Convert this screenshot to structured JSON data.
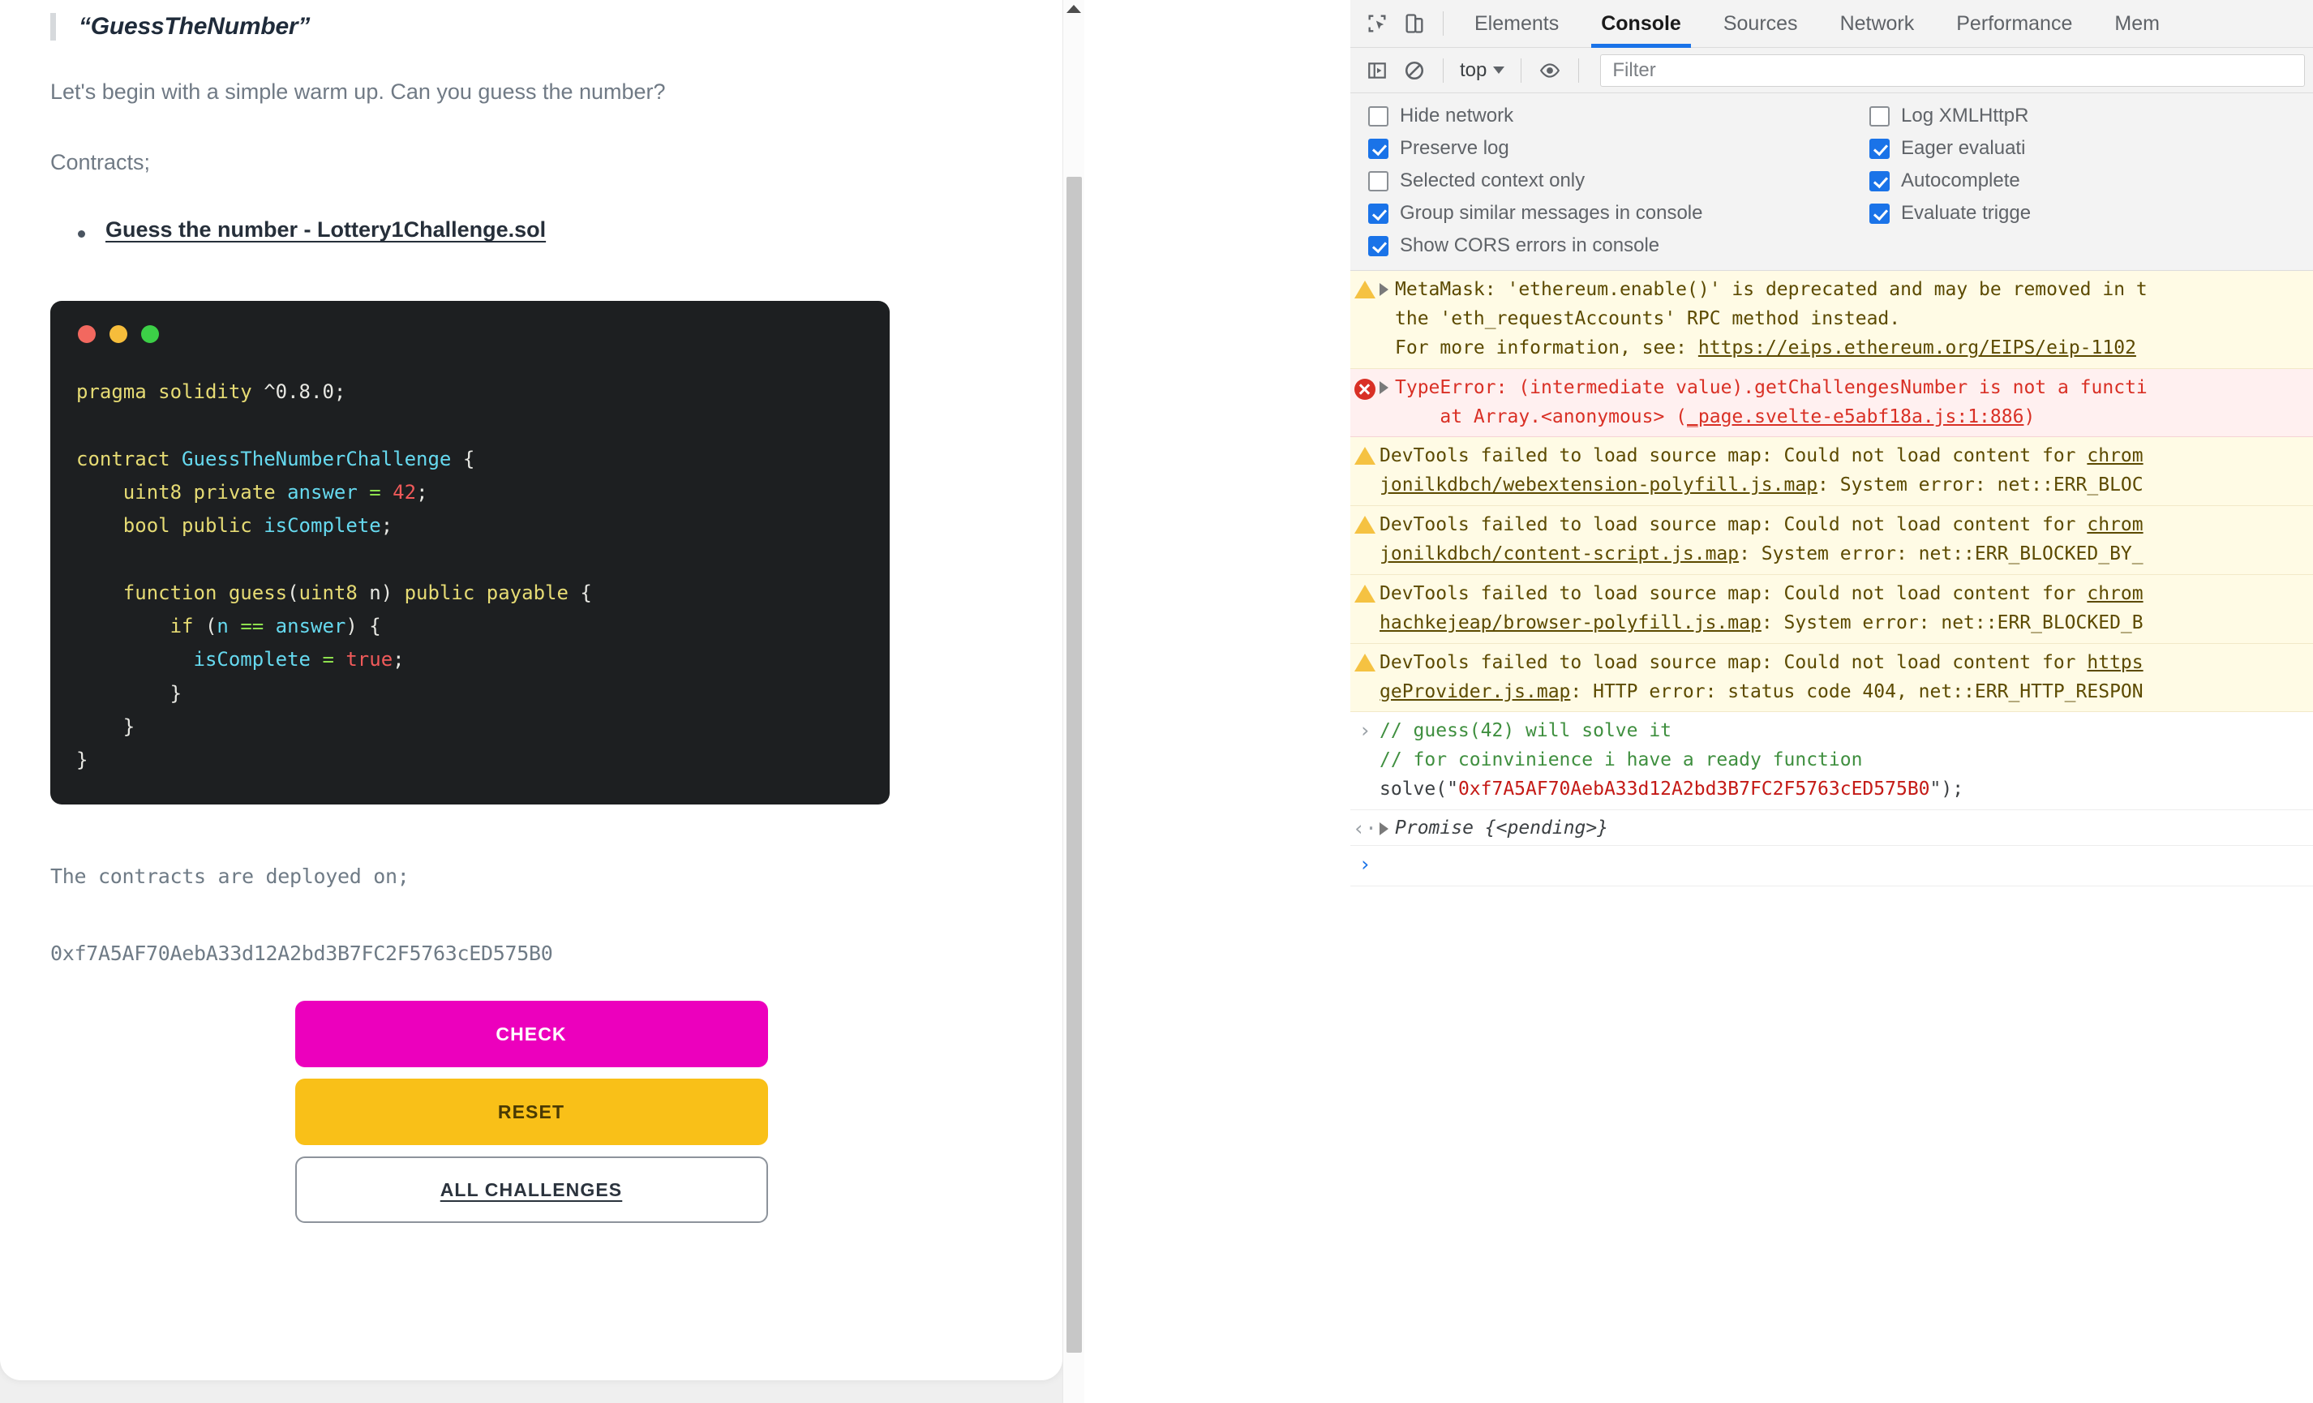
{
  "page": {
    "title": "“GuessTheNumber”",
    "intro": "Let's begin with a simple warm up. Can you guess the number?",
    "contracts_label": "Contracts;",
    "contract_link": "Guess the number - Lottery1Challenge.sol",
    "deployed_label": "The contracts are deployed on;",
    "address": "0xf7A5AF70AebA33d12A2bd3B7FC2F5763cED575B0",
    "code": {
      "window_dots": [
        "red-dot",
        "yellow-dot",
        "green-dot"
      ],
      "lines": [
        "pragma solidity ^0.8.0;",
        "",
        "contract GuessTheNumberChallenge {",
        "    uint8 private answer = 42;",
        "    bool public isComplete;",
        "",
        "    function guess(uint8 n) public payable {",
        "        if (n == answer) {",
        "          isComplete = true;",
        "        }",
        "    }",
        "}"
      ]
    },
    "buttons": {
      "check": "CHECK",
      "reset": "RESET",
      "all_challenges": "ALL CHALLENGES"
    },
    "colors": {
      "check_bg": "#ec00bd",
      "check_fg": "#ffffff",
      "reset_bg": "#f9c018",
      "reset_fg": "#4a3a04",
      "all_border": "#8d939b"
    }
  },
  "devtools": {
    "toolbar_icons": [
      "inspect-element-icon",
      "device-toolbar-icon"
    ],
    "tabs": [
      {
        "label": "Elements",
        "active": false
      },
      {
        "label": "Console",
        "active": true
      },
      {
        "label": "Sources",
        "active": false
      },
      {
        "label": "Network",
        "active": false
      },
      {
        "label": "Performance",
        "active": false
      },
      {
        "label": "Mem",
        "active": false
      }
    ],
    "filterbar": {
      "sidebar_icon": "console-sidebar-icon",
      "clear_icon": "clear-console-icon",
      "context": "top",
      "eye_icon": "live-expression-icon",
      "filter_placeholder": "Filter",
      "filter_value": ""
    },
    "settings": {
      "left": [
        {
          "label": "Hide network",
          "checked": false
        },
        {
          "label": "Preserve log",
          "checked": true
        },
        {
          "label": "Selected context only",
          "checked": false
        },
        {
          "label": "Group similar messages in console",
          "checked": true
        },
        {
          "label": "Show CORS errors in console",
          "checked": true
        }
      ],
      "right": [
        {
          "label": "Log XMLHttpR",
          "checked": false
        },
        {
          "label": "Eager evaluati",
          "checked": true
        },
        {
          "label": "Autocomplete",
          "checked": true
        },
        {
          "label": "Evaluate trigge",
          "checked": true
        }
      ]
    },
    "messages": [
      {
        "kind": "warn",
        "expandable": true,
        "lines": [
          "MetaMask: 'ethereum.enable()' is deprecated and may be removed in t",
          "the 'eth_requestAccounts' RPC method instead.",
          "For more information, see: https://eips.ethereum.org/EIPS/eip-1102"
        ],
        "link": "https://eips.ethereum.org/EIPS/eip-1102"
      },
      {
        "kind": "error",
        "expandable": true,
        "lines": [
          "TypeError: (intermediate value).getChallengesNumber is not a functi",
          "    at Array.<anonymous> (_page.svelte-e5abf18a.js:1:886)"
        ],
        "link": "_page.svelte-e5abf18a.js:1:886"
      },
      {
        "kind": "warn",
        "expandable": false,
        "lines": [
          "DevTools failed to load source map: Could not load content for chrom",
          "jonilkdbch/webextension-polyfill.js.map: System error: net::ERR_BLOC"
        ]
      },
      {
        "kind": "warn",
        "expandable": false,
        "lines": [
          "DevTools failed to load source map: Could not load content for chrom",
          "jonilkdbch/content-script.js.map: System error: net::ERR_BLOCKED_BY_"
        ]
      },
      {
        "kind": "warn",
        "expandable": false,
        "lines": [
          "DevTools failed to load source map: Could not load content for chrom",
          "hachkejeap/browser-polyfill.js.map: System error: net::ERR_BLOCKED_B"
        ]
      },
      {
        "kind": "warn",
        "expandable": false,
        "lines": [
          "DevTools failed to load source map: Could not load content for https",
          "geProvider.js.map: HTTP error: status code 404, net::ERR_HTTP_RESPON"
        ]
      }
    ],
    "input_entry": {
      "marker": "›",
      "comment1": "// guess(42) will solve it",
      "comment2": "// for coinvinience i have a ready function",
      "call_prefix": "solve(\"",
      "call_address": "0xf7A5AF70AebA33d12A2bd3B7FC2F5763cED575B0",
      "call_suffix": "\");"
    },
    "result_entry": {
      "marker": "‹·",
      "text": "Promise {<pending>}"
    },
    "prompt_marker": "›"
  }
}
